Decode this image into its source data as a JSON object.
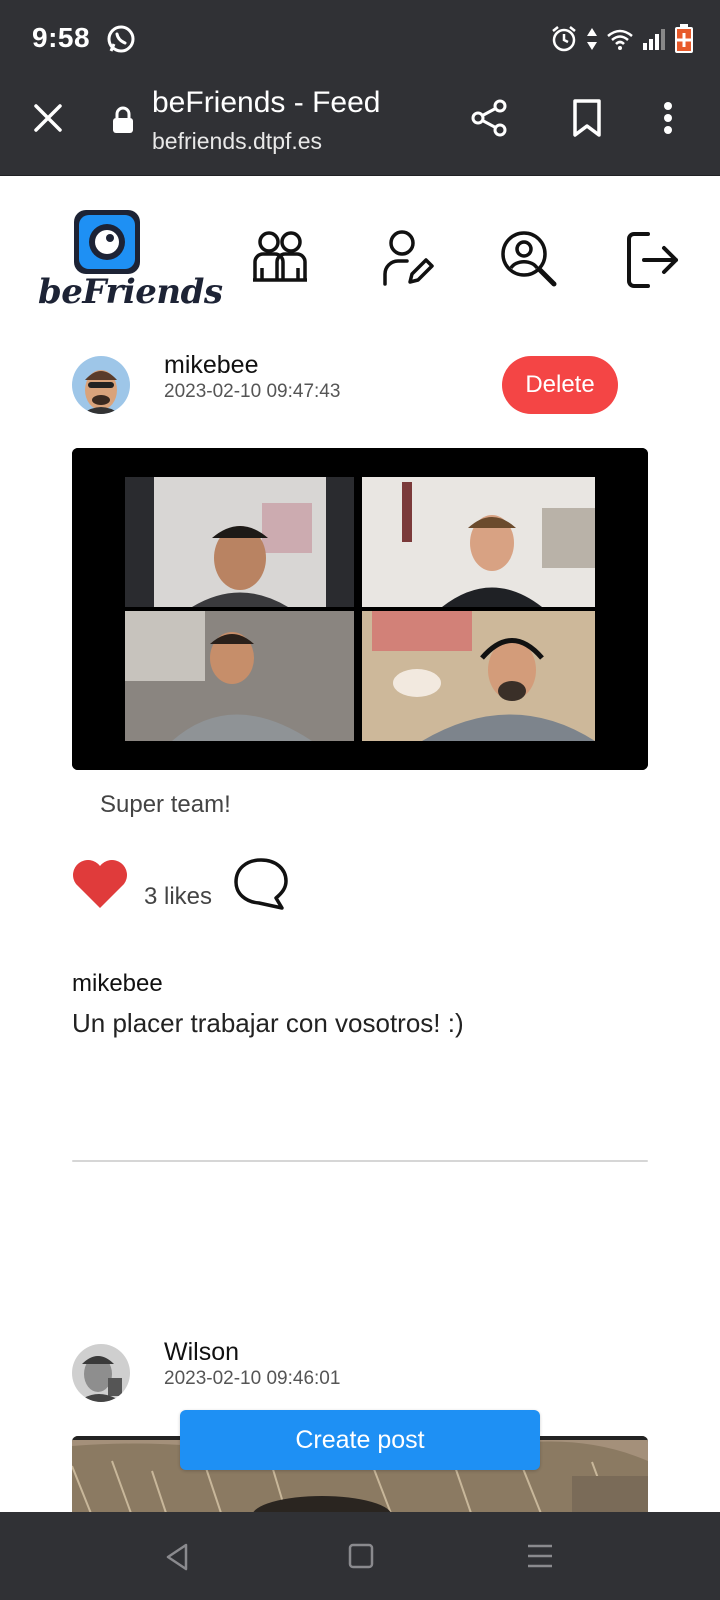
{
  "status_bar": {
    "time": "9:58"
  },
  "browser": {
    "page_title": "beFriends - Feed",
    "url": "befriends.dtpf.es"
  },
  "app": {
    "logo_text": "beFriends",
    "nav": [
      "friends-icon",
      "edit-profile-icon",
      "search-user-icon",
      "logout-icon"
    ]
  },
  "posts": [
    {
      "author": "mikebee",
      "timestamp": "2023-02-10 09:47:43",
      "delete_label": "Delete",
      "caption": "Super team!",
      "likes_text": "3 likes",
      "comments": [
        {
          "author": "mikebee",
          "text": "Un placer trabajar con vosotros! :)"
        }
      ]
    },
    {
      "author": "Wilson",
      "timestamp": "2023-02-10 09:46:01"
    }
  ],
  "create_post_label": "Create post",
  "colors": {
    "accent": "#1e90f4",
    "delete": "#f44545",
    "like": "#e03b3b",
    "chrome": "#303135"
  }
}
